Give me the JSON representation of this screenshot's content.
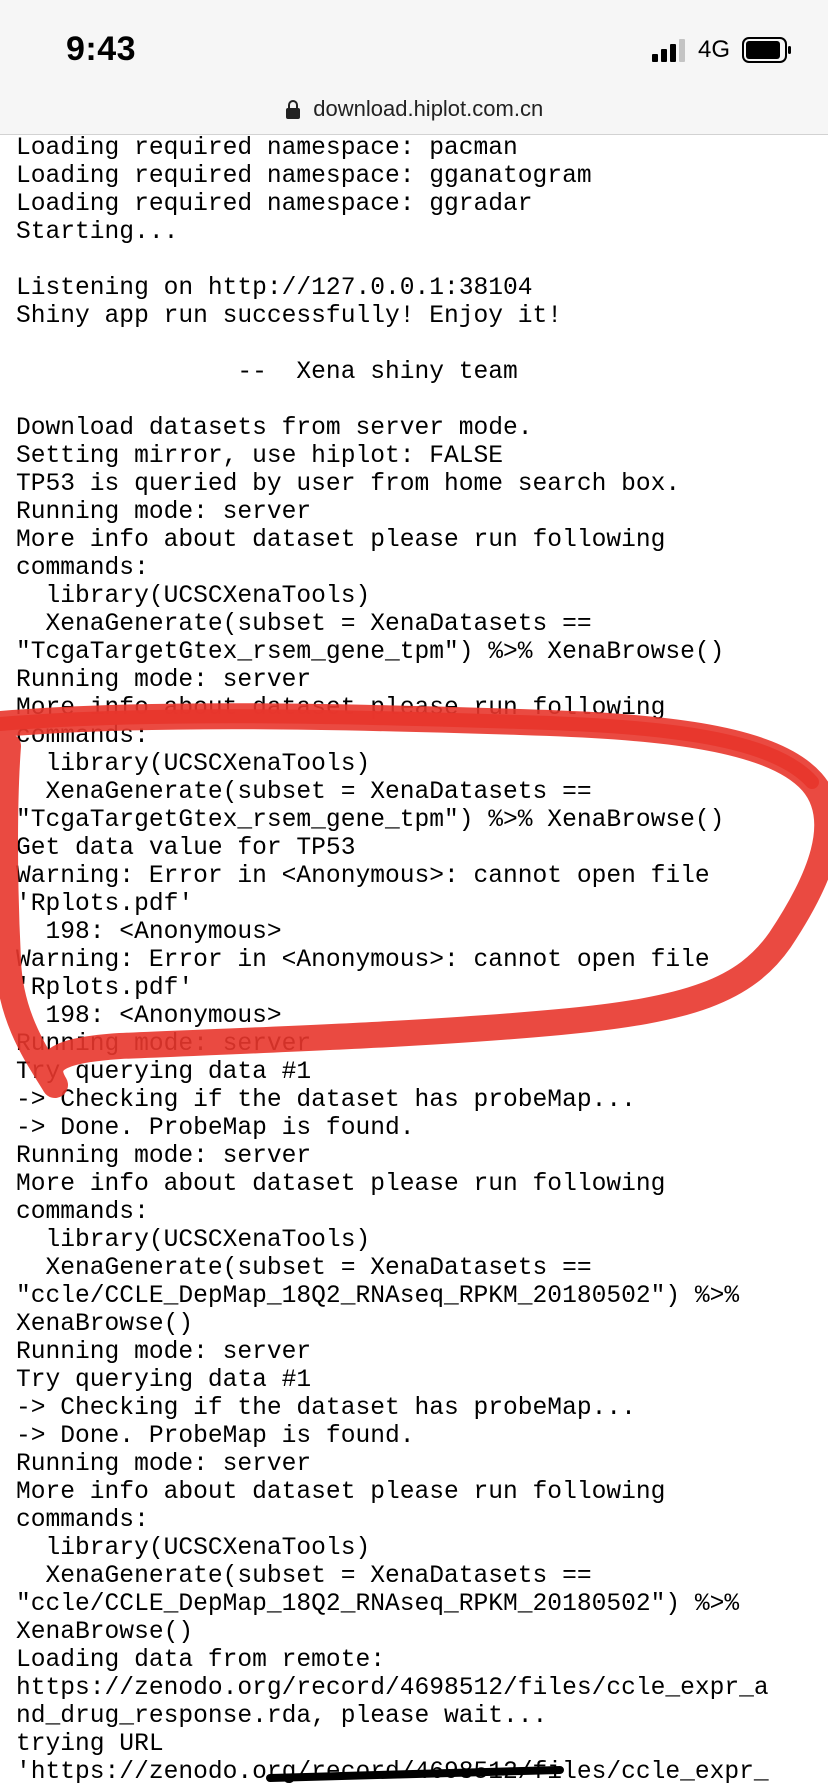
{
  "status_bar": {
    "time": "9:43",
    "network": "4G",
    "icons": [
      "signal-icon",
      "battery-icon"
    ]
  },
  "address_bar": {
    "url": "download.hiplot.com.cn",
    "icon": "lock-icon"
  },
  "console": {
    "lines": [
      "Loading required namespace: pacman",
      "Loading required namespace: gganatogram",
      "Loading required namespace: ggradar",
      "Starting...",
      "",
      "Listening on http://127.0.0.1:38104",
      "Shiny app run successfully! Enjoy it!",
      "",
      "               --  Xena shiny team",
      "",
      "Download datasets from server mode.",
      "Setting mirror, use hiplot: FALSE",
      "TP53 is queried by user from home search box.",
      "Running mode: server",
      "More info about dataset please run following",
      "commands:",
      "  library(UCSCXenaTools)",
      "  XenaGenerate(subset = XenaDatasets ==",
      "\"TcgaTargetGtex_rsem_gene_tpm\") %>% XenaBrowse()",
      "Running mode: server",
      "More info about dataset please run following",
      "commands:",
      "  library(UCSCXenaTools)",
      "  XenaGenerate(subset = XenaDatasets ==",
      "\"TcgaTargetGtex_rsem_gene_tpm\") %>% XenaBrowse()",
      "Get data value for TP53",
      "Warning: Error in <Anonymous>: cannot open file",
      "'Rplots.pdf'",
      "  198: <Anonymous>",
      "Warning: Error in <Anonymous>: cannot open file",
      "'Rplots.pdf'",
      "  198: <Anonymous>",
      "Running mode: server",
      "Try querying data #1",
      "-> Checking if the dataset has probeMap...",
      "-> Done. ProbeMap is found.",
      "Running mode: server",
      "More info about dataset please run following",
      "commands:",
      "  library(UCSCXenaTools)",
      "  XenaGenerate(subset = XenaDatasets ==",
      "\"ccle/CCLE_DepMap_18Q2_RNAseq_RPKM_20180502\") %>%",
      "XenaBrowse()",
      "Running mode: server",
      "Try querying data #1",
      "-> Checking if the dataset has probeMap...",
      "-> Done. ProbeMap is found.",
      "Running mode: server",
      "More info about dataset please run following",
      "commands:",
      "  library(UCSCXenaTools)",
      "  XenaGenerate(subset = XenaDatasets ==",
      "\"ccle/CCLE_DepMap_18Q2_RNAseq_RPKM_20180502\") %>%",
      "XenaBrowse()",
      "Loading data from remote:",
      "https://zenodo.org/record/4698512/files/ccle_expr_a",
      "nd_drug_response.rda, please wait...",
      "trying URL",
      "'https://zenodo.org/record/4698512/files/ccle_expr_"
    ]
  },
  "annotation": {
    "color": "#e8362c",
    "shape": "hand-drawn circle around warning lines"
  }
}
